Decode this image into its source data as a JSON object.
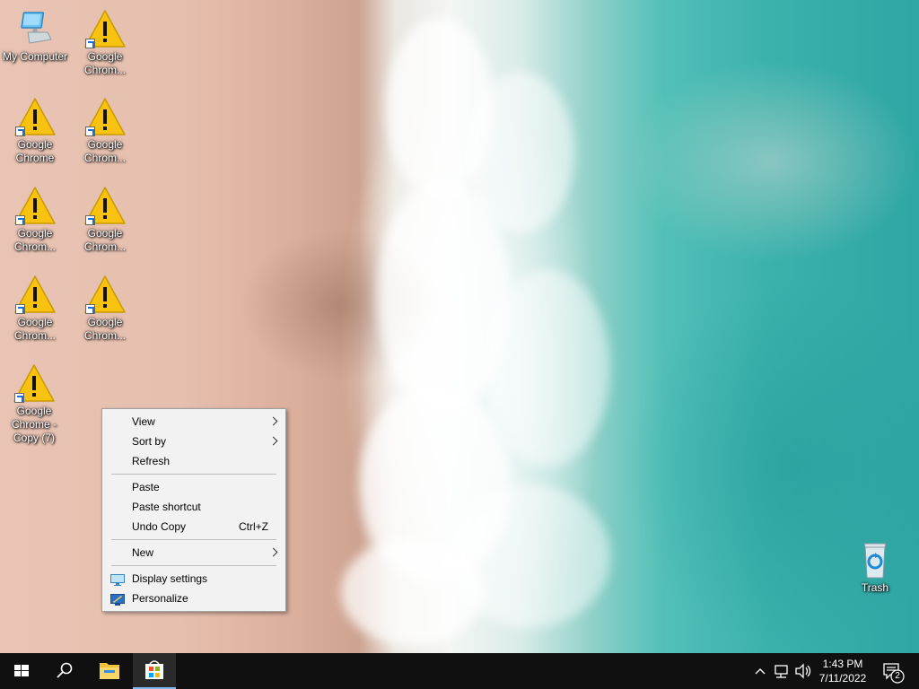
{
  "desktop": {
    "icons": [
      {
        "label": "My Computer"
      },
      {
        "label": "Google Chrom..."
      },
      {
        "label": "Google Chrome"
      },
      {
        "label": "Google Chrom..."
      },
      {
        "label": "Google Chrom..."
      },
      {
        "label": "Google Chrom..."
      },
      {
        "label": "Google Chrom..."
      },
      {
        "label": "Google Chrom..."
      },
      {
        "label": "Google Chrome - Copy (7)"
      },
      {
        "label": "Trash"
      }
    ]
  },
  "context_menu": {
    "items": [
      {
        "label": "View",
        "submenu": true
      },
      {
        "label": "Sort by",
        "submenu": true
      },
      {
        "label": "Refresh"
      },
      {
        "label": "Paste"
      },
      {
        "label": "Paste shortcut"
      },
      {
        "label": "Undo Copy",
        "shortcut": "Ctrl+Z"
      },
      {
        "label": "New",
        "submenu": true
      },
      {
        "label": "Display settings",
        "icon": "display-icon"
      },
      {
        "label": "Personalize",
        "icon": "personalize-icon"
      }
    ]
  },
  "taskbar": {
    "buttons": [
      {
        "icon": "windows-start-icon"
      },
      {
        "icon": "search-icon"
      },
      {
        "icon": "file-explorer-icon"
      },
      {
        "icon": "microsoft-store-icon"
      }
    ],
    "tray": {
      "icons": [
        "chevron-up-icon",
        "network-icon",
        "volume-icon"
      ],
      "time": "1:43 PM",
      "date": "7/11/2022",
      "notification_count": "2"
    }
  },
  "colors": {
    "taskbar": "#101010",
    "menu_bg": "#f2f2f2",
    "warning_yellow": "#f7c210",
    "accent_blue": "#1f6fd1"
  }
}
